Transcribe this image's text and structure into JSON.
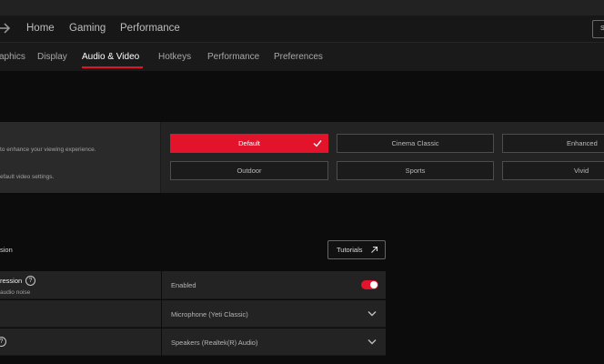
{
  "main_nav": {
    "items": [
      "Home",
      "Gaming",
      "Performance"
    ],
    "search_label": "Se"
  },
  "tabs": [
    {
      "label": "aphics",
      "active": false
    },
    {
      "label": "Display",
      "active": false
    },
    {
      "label": "Audio & Video",
      "active": true
    },
    {
      "label": "Hotkeys",
      "active": false
    },
    {
      "label": "Performance",
      "active": false
    },
    {
      "label": "Preferences",
      "active": false
    }
  ],
  "video": {
    "description": "to enhance your viewing experience.",
    "default_note": "efault video settings.",
    "profiles": [
      {
        "label": "Default",
        "selected": true
      },
      {
        "label": "Cinema Classic",
        "selected": false
      },
      {
        "label": "Enhanced",
        "selected": false
      },
      {
        "label": "Outdoor",
        "selected": false
      },
      {
        "label": "Sports",
        "selected": false
      },
      {
        "label": "Vivid",
        "selected": false
      }
    ]
  },
  "audio": {
    "section_label": "sion",
    "tutorials_label": "Tutorials",
    "noise_suppression": {
      "title": "ression",
      "subtitle": "audio noise",
      "value": "Enabled",
      "enabled": true
    },
    "microphone": {
      "value": "Microphone (Yeti Classic)"
    },
    "speakers": {
      "value": "Speakers (Realtek(R) Audio)"
    }
  },
  "colors": {
    "accent": "#e3132b",
    "background": "#0c0c0c",
    "panel": "#232323"
  },
  "icons": {
    "back": "arrow-right-icon",
    "check": "check-icon",
    "external": "external-link-icon",
    "help": "question-circle-icon",
    "chevron": "chevron-down-icon"
  }
}
